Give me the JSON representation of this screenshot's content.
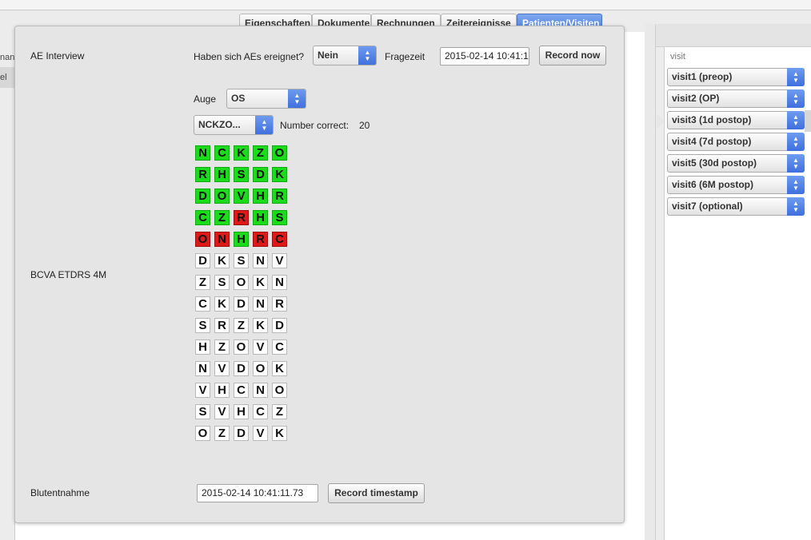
{
  "tabs": [
    {
      "label": "Eigenschaften",
      "active": false
    },
    {
      "label": "Dokumente",
      "active": false
    },
    {
      "label": "Rechnungen",
      "active": false
    },
    {
      "label": "Zeitereignisse",
      "active": false
    },
    {
      "label": "Patienten/Visiten",
      "active": true
    }
  ],
  "left_list": {
    "header": "nan",
    "row": "el"
  },
  "visits": {
    "header": "visit",
    "items": [
      "visit1 (preop)",
      "visit2 (OP)",
      "visit3 (1d postop)",
      "visit4 (7d postop)",
      "visit5 (30d postop)",
      "visit6 (6M postop)",
      "visit7 (optional)"
    ],
    "selected_index": 2
  },
  "ae": {
    "section_label": "AE Interview",
    "question": "Haben sich AEs ereignet?",
    "answer": "Nein",
    "time_label": "Fragezeit",
    "time_value": "2015-02-14 10:41:1",
    "record_button": "Record now"
  },
  "bcva": {
    "section_label": "BCVA ETDRS 4M",
    "eye_label": "Auge",
    "eye_value": "OS",
    "chart_select": "NCKZO...",
    "correct_label": "Number correct:",
    "correct_value": "20",
    "rows": [
      {
        "letters": [
          "N",
          "C",
          "K",
          "Z",
          "O"
        ],
        "status": [
          "c",
          "c",
          "c",
          "c",
          "c"
        ]
      },
      {
        "letters": [
          "R",
          "H",
          "S",
          "D",
          "K"
        ],
        "status": [
          "c",
          "c",
          "c",
          "c",
          "c"
        ]
      },
      {
        "letters": [
          "D",
          "O",
          "V",
          "H",
          "R"
        ],
        "status": [
          "c",
          "c",
          "c",
          "c",
          "c"
        ]
      },
      {
        "letters": [
          "C",
          "Z",
          "R",
          "H",
          "S"
        ],
        "status": [
          "c",
          "c",
          "w",
          "c",
          "c"
        ]
      },
      {
        "letters": [
          "O",
          "N",
          "H",
          "R",
          "C"
        ],
        "status": [
          "w",
          "w",
          "c",
          "w",
          "w"
        ]
      },
      {
        "letters": [
          "D",
          "K",
          "S",
          "N",
          "V"
        ],
        "status": [
          "n",
          "n",
          "n",
          "n",
          "n"
        ]
      },
      {
        "letters": [
          "Z",
          "S",
          "O",
          "K",
          "N"
        ],
        "status": [
          "n",
          "n",
          "n",
          "n",
          "n"
        ]
      },
      {
        "letters": [
          "C",
          "K",
          "D",
          "N",
          "R"
        ],
        "status": [
          "n",
          "n",
          "n",
          "n",
          "n"
        ]
      },
      {
        "letters": [
          "S",
          "R",
          "Z",
          "K",
          "D"
        ],
        "status": [
          "n",
          "n",
          "n",
          "n",
          "n"
        ]
      },
      {
        "letters": [
          "H",
          "Z",
          "O",
          "V",
          "C"
        ],
        "status": [
          "n",
          "n",
          "n",
          "n",
          "n"
        ]
      },
      {
        "letters": [
          "N",
          "V",
          "D",
          "O",
          "K"
        ],
        "status": [
          "n",
          "n",
          "n",
          "n",
          "n"
        ]
      },
      {
        "letters": [
          "V",
          "H",
          "C",
          "N",
          "O"
        ],
        "status": [
          "n",
          "n",
          "n",
          "n",
          "n"
        ]
      },
      {
        "letters": [
          "S",
          "V",
          "H",
          "C",
          "Z"
        ],
        "status": [
          "n",
          "n",
          "n",
          "n",
          "n"
        ]
      },
      {
        "letters": [
          "O",
          "Z",
          "D",
          "V",
          "K"
        ],
        "status": [
          "n",
          "n",
          "n",
          "n",
          "n"
        ]
      }
    ],
    "colors": {
      "correct": "#1bdc1b",
      "wrong": "#e01818",
      "neutral": "#ffffff"
    }
  },
  "blut": {
    "section_label": "Blutentnahme",
    "timestamp": "2015-02-14 10:41:11.73",
    "record_button": "Record timestamp"
  },
  "icons": {
    "select_arrow": "updown-chevron-icon"
  }
}
